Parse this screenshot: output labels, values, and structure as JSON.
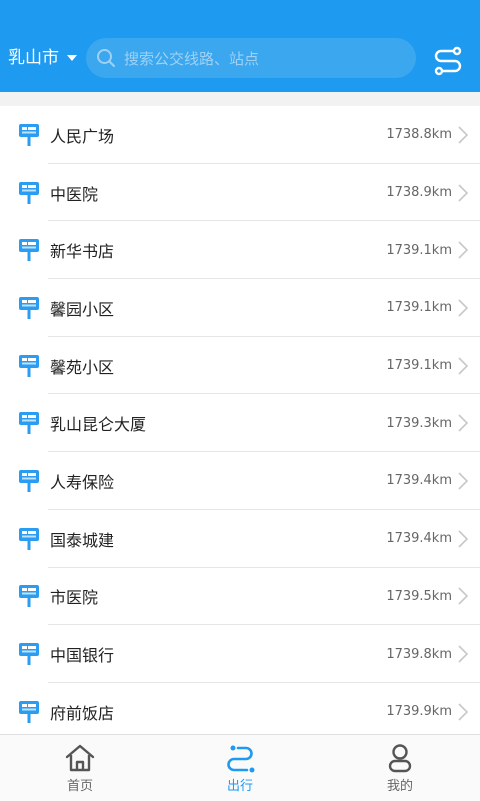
{
  "header": {
    "city": "乳山市",
    "search_placeholder": "搜索公交线路、站点",
    "accent": "#1e9af0"
  },
  "stops": [
    {
      "name": "人民广场",
      "distance": "1738.8km"
    },
    {
      "name": "中医院",
      "distance": "1738.9km"
    },
    {
      "name": "新华书店",
      "distance": "1739.1km"
    },
    {
      "name": "馨园小区",
      "distance": "1739.1km"
    },
    {
      "name": "馨苑小区",
      "distance": "1739.1km"
    },
    {
      "name": "乳山昆仑大厦",
      "distance": "1739.3km"
    },
    {
      "name": "人寿保险",
      "distance": "1739.4km"
    },
    {
      "name": "国泰城建",
      "distance": "1739.4km"
    },
    {
      "name": "市医院",
      "distance": "1739.5km"
    },
    {
      "name": "中国银行",
      "distance": "1739.8km"
    },
    {
      "name": "府前饭店",
      "distance": "1739.9km"
    }
  ],
  "nav": {
    "home": "首页",
    "travel": "出行",
    "mine": "我的"
  }
}
